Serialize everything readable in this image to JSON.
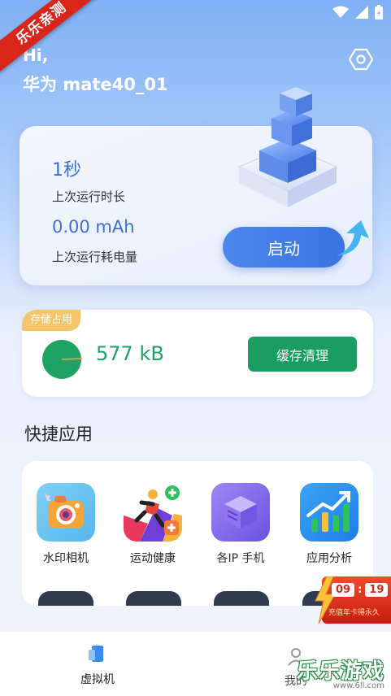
{
  "ribbon": {
    "text": "乐乐亲测"
  },
  "header": {
    "greeting": "Hi,",
    "device_name": "华为 mate40_01"
  },
  "run_card": {
    "time_value": "1秒",
    "time_label": "上次运行时长",
    "power_value": "0.00 mAh",
    "power_label": "上次运行耗电量",
    "start_label": "启动"
  },
  "storage": {
    "tag": "存储占用",
    "value": "577 kB",
    "clear_label": "缓存清理",
    "used_fraction": 0.01,
    "color": "#1fa364"
  },
  "quick_apps": {
    "title": "快捷应用",
    "items": [
      {
        "label": "水印相机",
        "icon": "camera-icon"
      },
      {
        "label": "运动健康",
        "icon": "running-icon"
      },
      {
        "label": "各IP 手机",
        "icon": "server-icon"
      },
      {
        "label": "应用分析",
        "icon": "chart-icon"
      }
    ]
  },
  "promo": {
    "hours": "09",
    "minutes": "19",
    "text": "充值年卡得永久"
  },
  "bottom_nav": {
    "vm_label": "虚拟机",
    "mine_label": "我的"
  },
  "watermark": {
    "text": "乐乐游戏",
    "url": "www.6ll.com"
  },
  "colors": {
    "accent_blue": "#3b73e0",
    "green": "#1b9d62",
    "tag_orange": "#f6c46b"
  }
}
